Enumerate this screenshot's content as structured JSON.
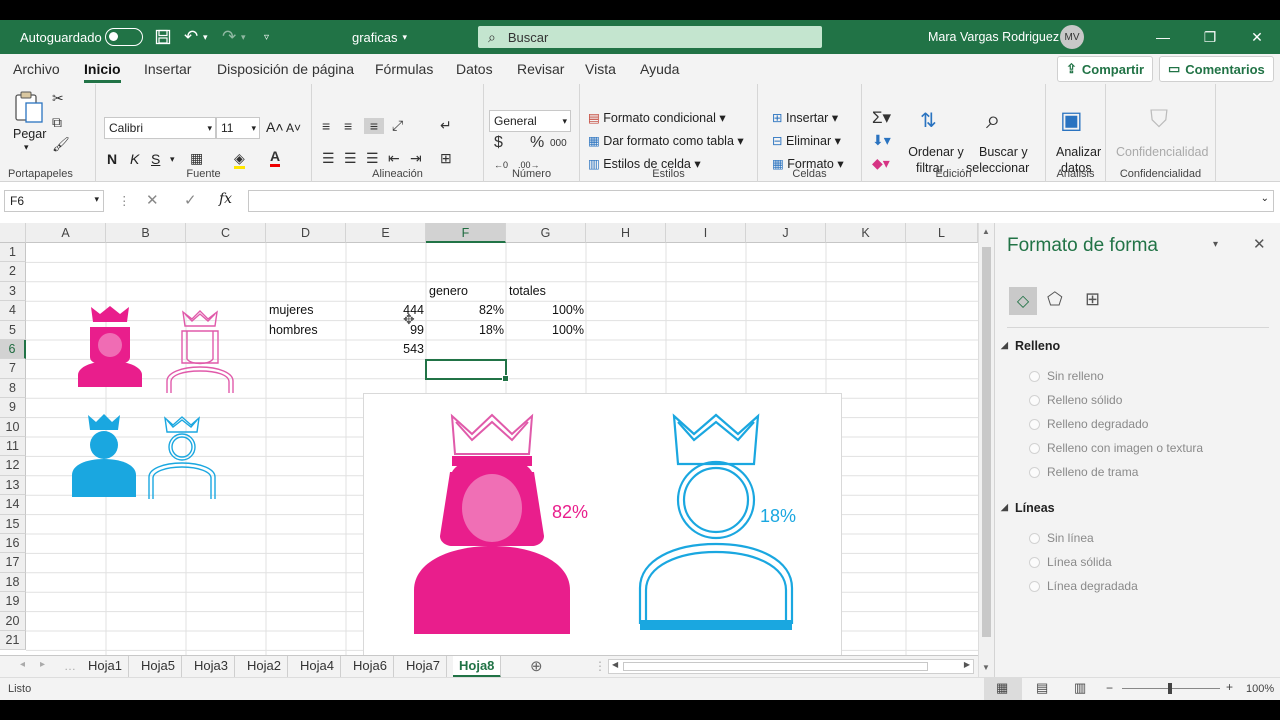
{
  "titlebar": {
    "autosave_label": "Autoguardado",
    "filename": "graficas",
    "search_placeholder": "Buscar",
    "user_name": "Mara Vargas Rodriguez",
    "user_initials": "MV"
  },
  "menu": {
    "tabs": [
      "Archivo",
      "Inicio",
      "Insertar",
      "Disposición de página",
      "Fórmulas",
      "Datos",
      "Revisar",
      "Vista",
      "Ayuda"
    ],
    "share": "Compartir",
    "comments": "Comentarios"
  },
  "ribbon": {
    "paste": "Pegar",
    "font_name": "Calibri",
    "font_size": "11",
    "bold": "N",
    "italic": "K",
    "underline": "S",
    "number_format": "General",
    "conditional": "Formato condicional",
    "as_table": "Dar formato como tabla",
    "cell_styles": "Estilos de celda",
    "insert": "Insertar",
    "delete": "Eliminar",
    "format": "Formato",
    "sort_filter_1": "Ordenar y",
    "sort_filter_2": "filtrar",
    "find_select_1": "Buscar y",
    "find_select_2": "seleccionar",
    "analyze_1": "Analizar",
    "analyze_2": "datos",
    "confidentiality": "Confidencialidad",
    "groups": {
      "clipboard": "Portapapeles",
      "font": "Fuente",
      "alignment": "Alineación",
      "number": "Número",
      "styles": "Estilos",
      "cells": "Celdas",
      "editing": "Edición",
      "analysis": "Análisis",
      "confidentiality": "Confidencialidad"
    }
  },
  "formula_bar": {
    "name_box": "F6",
    "fx": "fx",
    "content": ""
  },
  "grid": {
    "columns": [
      "A",
      "B",
      "C",
      "D",
      "E",
      "F",
      "G",
      "H",
      "I",
      "J",
      "K",
      "L"
    ],
    "rows": [
      "1",
      "2",
      "3",
      "4",
      "5",
      "6",
      "7",
      "8",
      "9",
      "10",
      "11",
      "12",
      "13",
      "14",
      "15",
      "16",
      "17",
      "18",
      "19",
      "20",
      "21"
    ],
    "cells": {
      "F2": "genero",
      "G2": "totales",
      "D3": "mujeres",
      "E3": "444",
      "F3": "82%",
      "G3": "100%",
      "D4": "hombres",
      "E4": "99",
      "F4": "18%",
      "G4": "100%",
      "E5": "543"
    },
    "selected_cell": "F6"
  },
  "chart": {
    "female_label": "82%",
    "male_label": "18%",
    "female_color": "#e91e8c",
    "male_color": "#1aa7e0"
  },
  "sheets": {
    "tabs": [
      "Hoja1",
      "Hoja5",
      "Hoja3",
      "Hoja2",
      "Hoja4",
      "Hoja6",
      "Hoja7",
      "Hoja8"
    ],
    "active": "Hoja8"
  },
  "status": {
    "mode": "Listo",
    "zoom": "100%"
  },
  "format_pane": {
    "title": "Formato de forma",
    "fill_section": "Relleno",
    "fill_options": [
      "Sin relleno",
      "Relleno sólido",
      "Relleno degradado",
      "Relleno con imagen o textura",
      "Relleno de trama"
    ],
    "line_section": "Líneas",
    "line_options": [
      "Sin línea",
      "Línea sólida",
      "Línea degradada"
    ]
  },
  "colors": {
    "excel_green": "#217346",
    "pink": "#e91e8c",
    "blue": "#1aa7e0"
  }
}
